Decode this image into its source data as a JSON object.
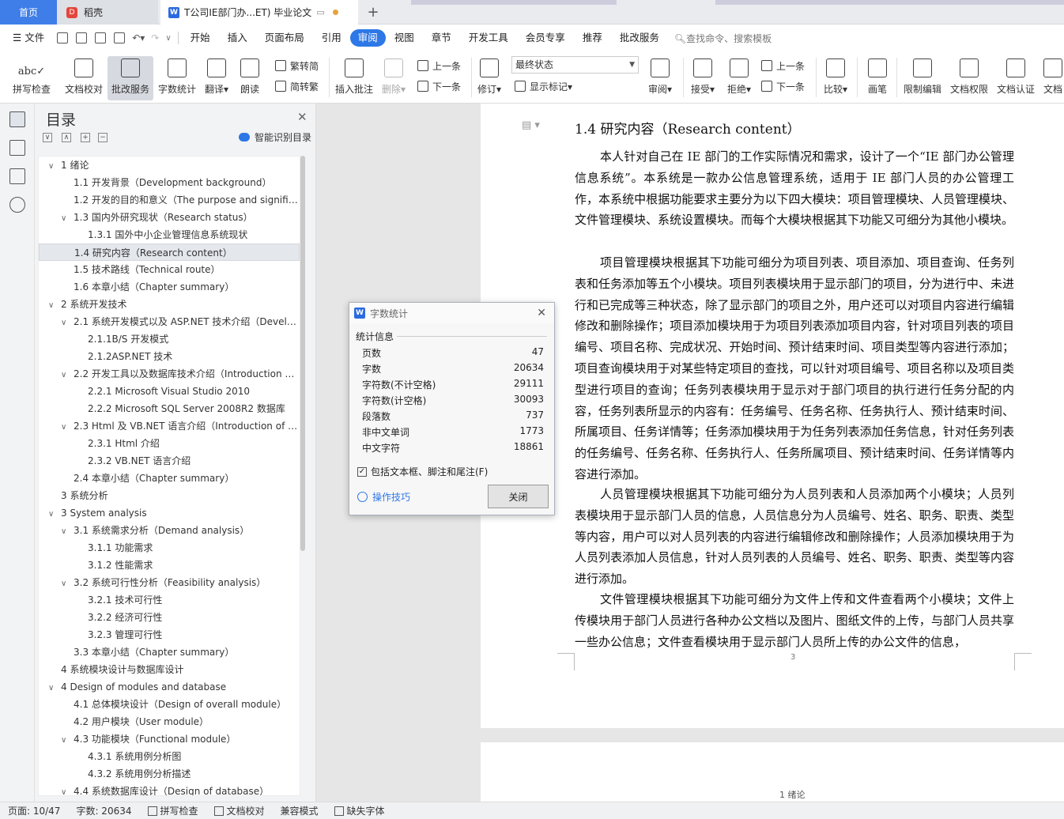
{
  "tabs": {
    "home": "首页",
    "daoke": "稻壳",
    "doc": "T公司IE部门办...ET)  毕业论文"
  },
  "menu": {
    "file": "文件",
    "items": [
      "开始",
      "插入",
      "页面布局",
      "引用",
      "审阅",
      "视图",
      "章节",
      "开发工具",
      "会员专享",
      "推荐",
      "批改服务"
    ],
    "search_placeholder": "查找命令、搜索模板"
  },
  "ribbon": {
    "spellcheck": "拼写检查",
    "proofread": "文档校对",
    "grading": "批改服务",
    "wordcount": "字数统计",
    "translate": "翻译",
    "read_aloud": "朗读",
    "trad": "繁转简",
    "simp": "简转繁",
    "insert_comment": "插入批注",
    "delete": "删除",
    "prev": "上一条",
    "next": "下一条",
    "revise": "修订",
    "final_state": "最终状态",
    "show_marks": "显示标记",
    "review": "审阅",
    "accept": "接受",
    "reject": "拒绝",
    "prev2": "上一条",
    "next2": "下一条",
    "compare": "比较",
    "pen": "画笔",
    "restrict": "限制编辑",
    "doc_rights": "文档权限",
    "doc_auth": "文档认证",
    "doc_more": "文档"
  },
  "toc": {
    "title": "目录",
    "smart": "智能识别目录",
    "items": [
      {
        "text": "1  绪论",
        "level": 1,
        "tw": "∨"
      },
      {
        "text": "1.1 开发背景（Development background）",
        "level": 2,
        "tw": ""
      },
      {
        "text": "1.2 开发的目的和意义（The purpose and signifi…",
        "level": 2,
        "tw": ""
      },
      {
        "text": "1.3 国内外研究现状（Research status）",
        "level": 2,
        "tw": "∨"
      },
      {
        "text": "1.3.1  国外中小企业管理信息系统现状",
        "level": 3,
        "tw": ""
      },
      {
        "text": "1.4 研究内容（Research content）",
        "level": 2,
        "tw": "",
        "selected": true
      },
      {
        "text": "1.5 技术路线（Technical route）",
        "level": 2,
        "tw": ""
      },
      {
        "text": "1.6 本章小结（Chapter summary）",
        "level": 2,
        "tw": ""
      },
      {
        "text": "2 系统开发技术",
        "level": 1,
        "tw": "∨"
      },
      {
        "text": "2.1 系统开发模式以及 ASP.NET 技术介绍（Devel…",
        "level": 2,
        "tw": "∨"
      },
      {
        "text": "2.1.1B/S 开发模式",
        "level": 3,
        "tw": ""
      },
      {
        "text": "2.1.2ASP.NET 技术",
        "level": 3,
        "tw": ""
      },
      {
        "text": "2.2 开发工具以及数据库技术介绍（Introduction …",
        "level": 2,
        "tw": "∨"
      },
      {
        "text": "2.2.1 Microsoft Visual Studio 2010",
        "level": 3,
        "tw": ""
      },
      {
        "text": "2.2.2 Microsoft    SQL Server 2008R2 数据库",
        "level": 3,
        "tw": ""
      },
      {
        "text": "2.3 Html 及 VB.NET 语言介绍（Introduction of …",
        "level": 2,
        "tw": "∨"
      },
      {
        "text": "2.3.1 Html 介绍",
        "level": 3,
        "tw": ""
      },
      {
        "text": "2.3.2 VB.NET 语言介绍",
        "level": 3,
        "tw": ""
      },
      {
        "text": "2.4 本章小结（Chapter summary）",
        "level": 2,
        "tw": ""
      },
      {
        "text": "3 系统分析",
        "level": 1,
        "tw": ""
      },
      {
        "text": "3 System analysis",
        "level": 1,
        "tw": "∨"
      },
      {
        "text": "3.1 系统需求分析（Demand analysis）",
        "level": 2,
        "tw": "∨"
      },
      {
        "text": "3.1.1 功能需求",
        "level": 3,
        "tw": ""
      },
      {
        "text": "3.1.2  性能需求",
        "level": 3,
        "tw": ""
      },
      {
        "text": "3.2  系统可行性分析（Feasibility analysis）",
        "level": 2,
        "tw": "∨"
      },
      {
        "text": "3.2.1  技术可行性",
        "level": 3,
        "tw": ""
      },
      {
        "text": "3.2.2  经济可行性",
        "level": 3,
        "tw": ""
      },
      {
        "text": "3.2.3 管理可行性",
        "level": 3,
        "tw": ""
      },
      {
        "text": "3.3 本章小结（Chapter summary）",
        "level": 2,
        "tw": ""
      },
      {
        "text": "4 系统模块设计与数据库设计",
        "level": 1,
        "tw": ""
      },
      {
        "text": "4 Design of modules and database",
        "level": 1,
        "tw": "∨"
      },
      {
        "text": "4.1 总体模块设计（Design of overall module）",
        "level": 2,
        "tw": ""
      },
      {
        "text": "4.2  用户模块（User module）",
        "level": 2,
        "tw": ""
      },
      {
        "text": "4.3  功能模块（Functional module）",
        "level": 2,
        "tw": "∨"
      },
      {
        "text": "4.3.1  系统用例分析图",
        "level": 3,
        "tw": ""
      },
      {
        "text": "4.3.2 系统用例分析描述",
        "level": 3,
        "tw": ""
      },
      {
        "text": "4.4 系统数据库设计（Design of database）",
        "level": 2,
        "tw": "∨"
      }
    ]
  },
  "document": {
    "section_title": "1.4 研究内容（Research content）",
    "paragraphs": [
      "本人针对自己在 IE 部门的工作实际情况和需求，设计了一个“IE 部门办公管理信息系统”。本系统是一款办公信息管理系统，适用于 IE 部门人员的办公管理工作，本系统中根据功能要求主要分为以下四大模块：项目管理模块、人员管理模块、文件管理模块、系统设置模块。而每个大模块根据其下功能又可细分为其他小模块。",
      "项目管理模块根据其下功能可细分为项目列表、项目添加、项目查询、任务列表和任务添加等五个小模块。项目列表模块用于显示部门的项目，分为进行中、未进行和已完成等三种状态，除了显示部门的项目之外，用户还可以对项目内容进行编辑修改和删除操作；项目添加模块用于为项目列表添加项目内容，针对项目列表的项目编号、项目名称、完成状况、开始时间、预计结束时间、项目类型等内容进行添加；项目查询模块用于对某些特定项目的查找，可以针对项目编号、项目名称以及项目类型进行项目的查询；任务列表模块用于显示对于部门项目的执行进行任务分配的内容，任务列表所显示的内容有：任务编号、任务名称、任务执行人、预计结束时间、所属项目、任务详情等；任务添加模块用于为任务列表添加任务信息，针对任务列表的任务编号、任务名称、任务执行人、任务所属项目、预计结束时间、任务详情等内容进行添加。",
      "人员管理模块根据其下功能可细分为人员列表和人员添加两个小模块；人员列表模块用于显示部门人员的信息，人员信息分为人员编号、姓名、职务、职责、类型等内容，用户可以对人员列表的内容进行编辑修改和删除操作；人员添加模块用于为人员列表添加人员信息，针对人员列表的人员编号、姓名、职务、职责、类型等内容进行添加。",
      "文件管理模块根据其下功能可细分为文件上传和文件查看两个小模块；文件上传模块用于部门人员进行各种办公文档以及图片、图纸文件的上传，与部门人员共享一些办公信息；文件查看模块用于显示部门人员所上传的办公文件的信息，"
    ],
    "page_number": "3",
    "next_page_header": "1  绪论"
  },
  "dialog": {
    "title": "字数统计",
    "section": "统计信息",
    "rows": [
      {
        "label": "页数",
        "value": "47"
      },
      {
        "label": "字数",
        "value": "20634"
      },
      {
        "label": "字符数(不计空格)",
        "value": "29111"
      },
      {
        "label": "字符数(计空格)",
        "value": "30093"
      },
      {
        "label": "段落数",
        "value": "737"
      },
      {
        "label": "非中文单词",
        "value": "1773"
      },
      {
        "label": "中文字符",
        "value": "18861"
      }
    ],
    "include_label": "包括文本框、脚注和尾注(F)",
    "tips": "操作技巧",
    "close_btn": "关闭"
  },
  "status": {
    "page": "页面: 10/47",
    "words": "字数: 20634",
    "spell": "拼写检查",
    "proof": "文档校对",
    "compat": "兼容模式",
    "missing_font": "缺失字体"
  },
  "colors": {
    "accent": "#2e77e6",
    "home_tab": "#3f7ee8"
  }
}
